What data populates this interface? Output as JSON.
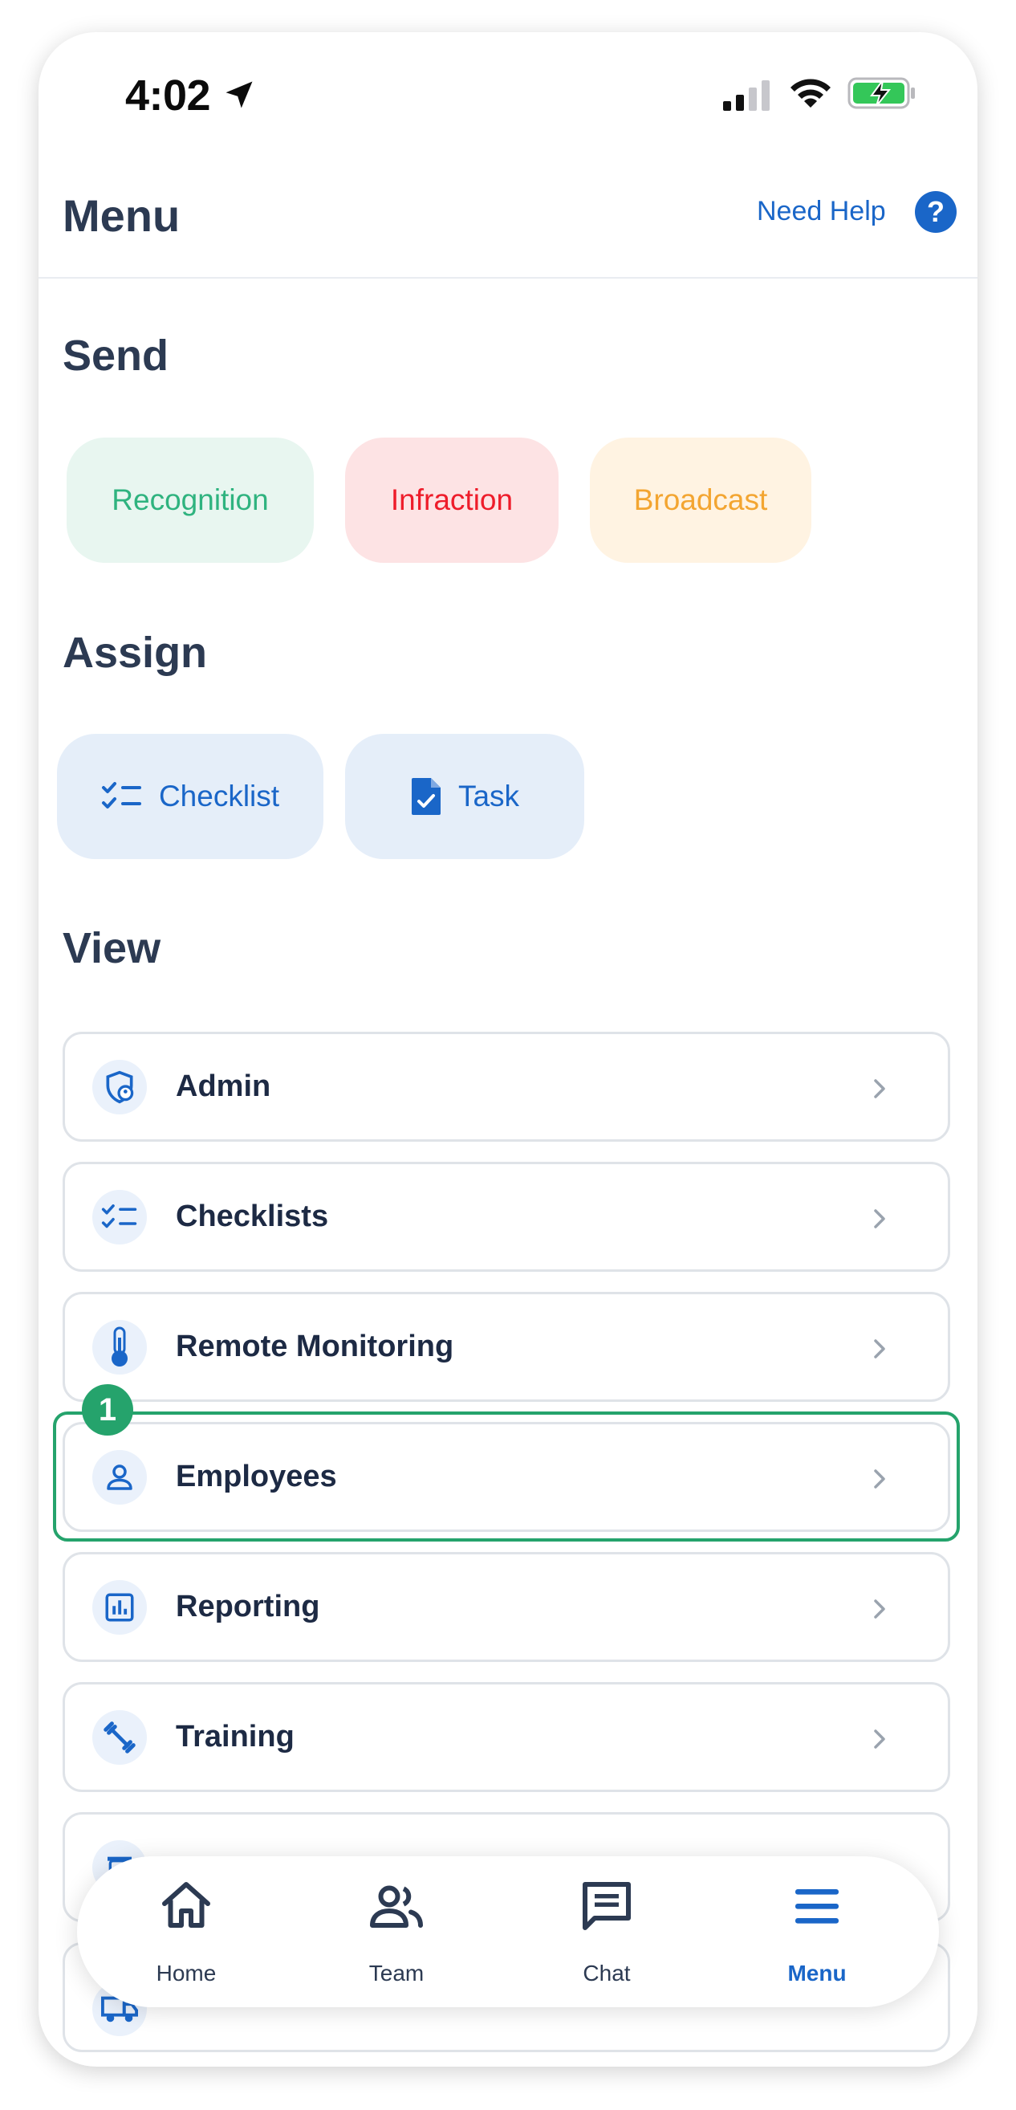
{
  "status_bar": {
    "time": "4:02"
  },
  "header": {
    "title": "Menu",
    "help_label": "Need Help",
    "help_icon_glyph": "?"
  },
  "send": {
    "title": "Send",
    "chips": [
      {
        "label": "Recognition",
        "color": "#2fb37f"
      },
      {
        "label": "Infraction",
        "color": "#ee1c2a"
      },
      {
        "label": "Broadcast",
        "color": "#f3a531"
      }
    ]
  },
  "assign": {
    "title": "Assign",
    "chips": [
      {
        "label": "Checklist",
        "icon": "checklist-icon"
      },
      {
        "label": "Task",
        "icon": "task-icon"
      }
    ]
  },
  "view": {
    "title": "View",
    "items": [
      {
        "label": "Admin",
        "icon": "admin-shield-icon"
      },
      {
        "label": "Checklists",
        "icon": "checklist-icon"
      },
      {
        "label": "Remote Monitoring",
        "icon": "thermometer-icon"
      },
      {
        "label": "Employees",
        "icon": "person-icon"
      },
      {
        "label": "Reporting",
        "icon": "bar-chart-icon"
      },
      {
        "label": "Training",
        "icon": "dumbbell-icon"
      },
      {
        "label": "",
        "icon": "waste-icon"
      },
      {
        "label": "",
        "icon": "truck-icon"
      }
    ]
  },
  "annotation": {
    "step_number": "1",
    "color": "#25a36c"
  },
  "tabbar": {
    "tabs": [
      {
        "label": "Home",
        "icon": "home-icon"
      },
      {
        "label": "Team",
        "icon": "team-icon"
      },
      {
        "label": "Chat",
        "icon": "chat-icon"
      },
      {
        "label": "Menu",
        "icon": "menu-icon",
        "active": true
      }
    ]
  },
  "colors": {
    "accent": "#1a66c8",
    "heading": "#2c3a52"
  }
}
